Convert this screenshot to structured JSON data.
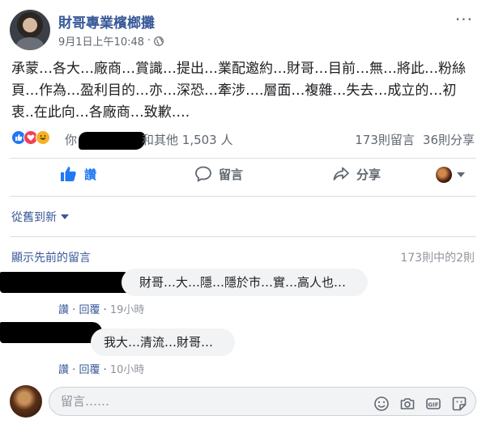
{
  "post": {
    "page_name": "財哥專業檳榔攤",
    "timestamp": "9月1日上午10:48",
    "separator": "·",
    "more": "···",
    "text": "承蒙…各大…廠商…賞識…提出…業配邀約…財哥…目前…無…將此…粉絲頁…作為…盈利目的…亦…深恐…牽涉….層面…複雜…失去…成立的…初衷..在此向…各廠商…致歉…."
  },
  "reactions": {
    "you": "你",
    "others": "和其他 1,503 人",
    "comments_count": "173則留言",
    "shares_count": "36則分享"
  },
  "actions": {
    "like": "讚",
    "comment": "留言",
    "share": "分享"
  },
  "sort": {
    "label": "從舊到新"
  },
  "comments_header": {
    "show_previous": "顯示先前的留言",
    "count": "173則中的2則"
  },
  "comments": [
    {
      "text": "財哥…大…隱…隱於市…實…高人也…",
      "like": "讚",
      "dot": "·",
      "reply": "回覆",
      "time": "19小時"
    },
    {
      "text": "我大…清流…財哥…",
      "like": "讚",
      "dot": "·",
      "reply": "回覆",
      "time": "10小時"
    }
  ],
  "composer": {
    "placeholder": "留言……"
  },
  "colors": {
    "link": "#385898",
    "like_blue": "#2078f4",
    "muted": "#606770",
    "bubble": "#f2f3f5"
  }
}
